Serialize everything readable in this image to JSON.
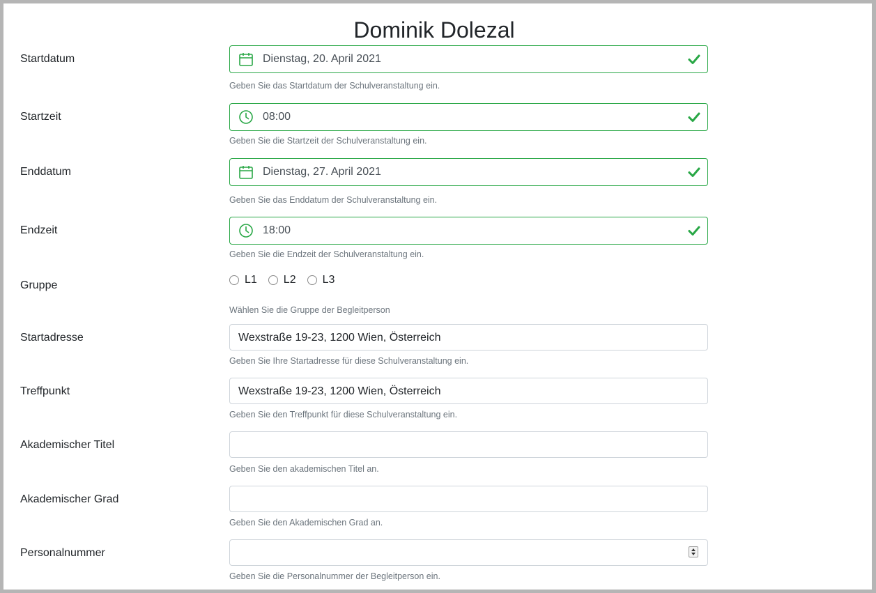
{
  "header": {
    "title": "Dominik Dolezal"
  },
  "colors": {
    "valid": "#28a745",
    "border": "#ced4da",
    "help_text": "#6c757d"
  },
  "fields": {
    "startdatum": {
      "label": "Startdatum",
      "value": "Dienstag, 20. April 2021",
      "help": "Geben Sie das Startdatum der Schulveranstaltung ein.",
      "icon": "calendar-icon",
      "status_icon": "check-icon"
    },
    "startzeit": {
      "label": "Startzeit",
      "value": "08:00",
      "help": "Geben Sie die Startzeit der Schulveranstaltung ein.",
      "icon": "clock-icon",
      "status_icon": "check-icon"
    },
    "enddatum": {
      "label": "Enddatum",
      "value": "Dienstag, 27. April 2021",
      "help": "Geben Sie das Enddatum der Schulveranstaltung ein.",
      "icon": "calendar-icon",
      "status_icon": "check-icon"
    },
    "endzeit": {
      "label": "Endzeit",
      "value": "18:00",
      "help": "Geben Sie die Endzeit der Schulveranstaltung ein.",
      "icon": "clock-icon",
      "status_icon": "check-icon"
    },
    "gruppe": {
      "label": "Gruppe",
      "options": [
        "L1",
        "L2",
        "L3"
      ],
      "selected": null,
      "help": "Wählen Sie die Gruppe der Begleitperson"
    },
    "startadresse": {
      "label": "Startadresse",
      "value": "Wexstraße 19-23, 1200 Wien, Österreich",
      "help": "Geben Sie Ihre Startadresse für diese Schulveranstaltung ein."
    },
    "treffpunkt": {
      "label": "Treffpunkt",
      "value": "Wexstraße 19-23, 1200 Wien, Österreich",
      "help": "Geben Sie den Treffpunkt für diese Schulveranstaltung ein."
    },
    "akad_titel": {
      "label": "Akademischer Titel",
      "value": "",
      "help": "Geben Sie den akademischen Titel an."
    },
    "akad_grad": {
      "label": "Akademischer Grad",
      "value": "",
      "help": "Geben Sie den Akademischen Grad an."
    },
    "personalnummer": {
      "label": "Personalnummer",
      "value": "",
      "help": "Geben Sie die Personalnummer der Begleitperson ein.",
      "icon": "spinner-icon"
    }
  }
}
